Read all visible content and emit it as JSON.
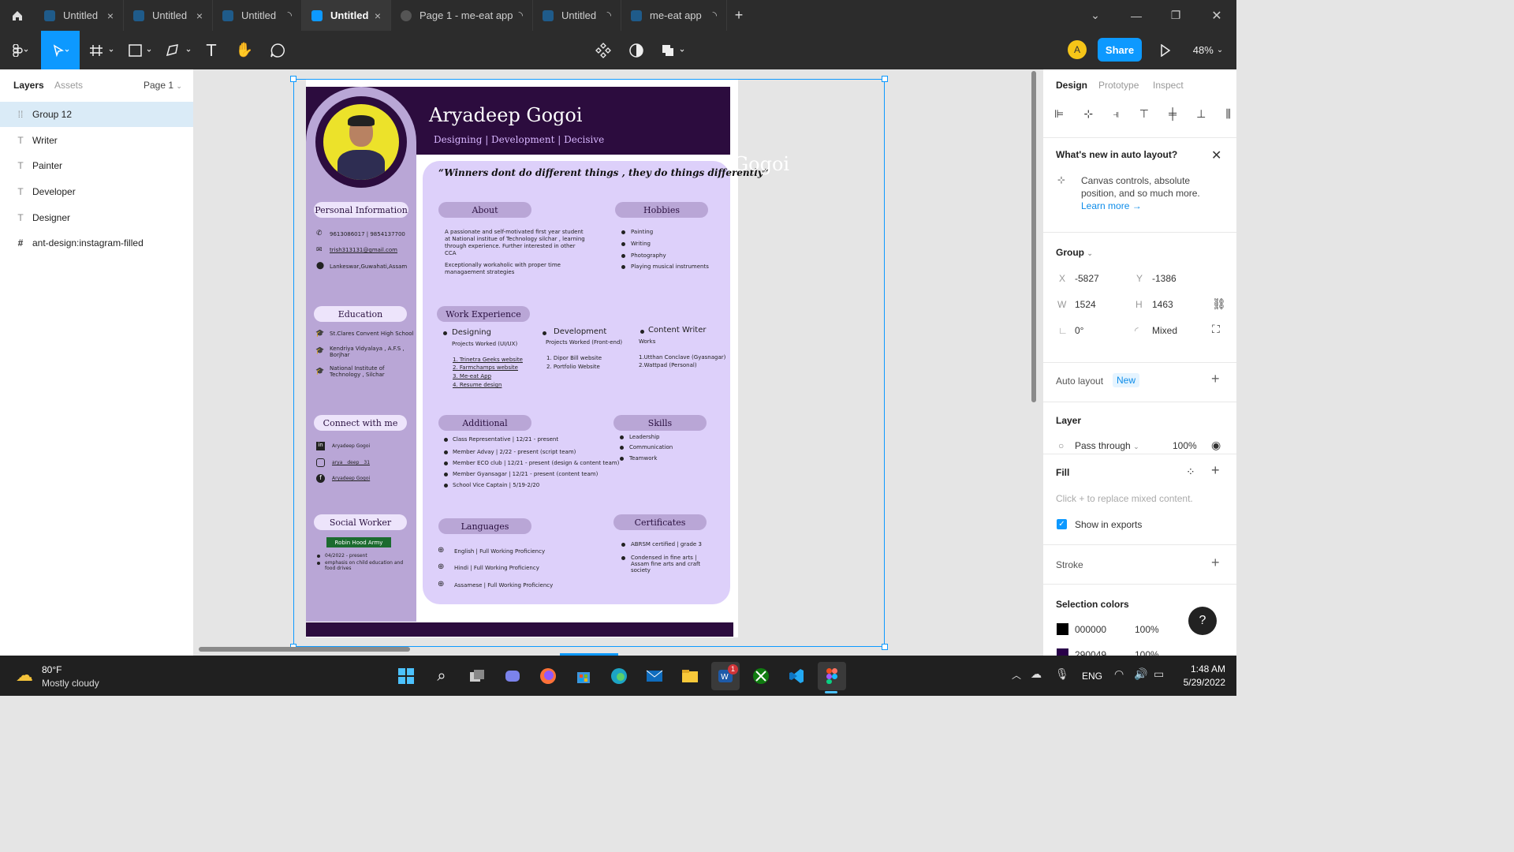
{
  "tabs": [
    {
      "label": "Untitled",
      "end": "×"
    },
    {
      "label": "Untitled",
      "end": "×"
    },
    {
      "label": "Untitled",
      "end": "◝"
    },
    {
      "label": "Untitled",
      "end": "×"
    },
    {
      "label": "Page 1 - me-eat app",
      "end": "◝"
    },
    {
      "label": "Untitled",
      "end": "◝"
    },
    {
      "label": "me-eat app",
      "end": "◝"
    }
  ],
  "toolbar": {
    "avatar": "A",
    "share": "Share",
    "zoom": "48%"
  },
  "left": {
    "tab_layers": "Layers",
    "tab_assets": "Assets",
    "page": "Page 1",
    "layers": [
      {
        "label": "Group 12",
        "icon": "group-icon"
      },
      {
        "label": "Writer",
        "icon": "text-icon"
      },
      {
        "label": "Painter",
        "icon": "text-icon"
      },
      {
        "label": "Developer",
        "icon": "text-icon"
      },
      {
        "label": "Designer",
        "icon": "text-icon"
      },
      {
        "label": "ant-design:instagram-filled",
        "icon": "frame-icon"
      }
    ]
  },
  "right": {
    "tabs": [
      "Design",
      "Prototype",
      "Inspect"
    ],
    "whatsnew_title": "What's new in auto layout?",
    "whatsnew_body": "Canvas controls, absolute position, and so much more.",
    "learn_more": "Learn more →",
    "group": "Group",
    "x_lbl": "X",
    "x": "-5827",
    "y_lbl": "Y",
    "y": "-1386",
    "w_lbl": "W",
    "w": "1524",
    "h_lbl": "H",
    "h": "1463",
    "rot": "0°",
    "radius": "Mixed",
    "autolayout": "Auto layout",
    "new_badge": "New",
    "layer": "Layer",
    "blend": "Pass through",
    "opacity": "100%",
    "fill": "Fill",
    "fill_hint": "Click + to replace mixed content.",
    "show_exports": "Show in exports",
    "stroke": "Stroke",
    "selection_colors": "Selection colors",
    "colors": [
      {
        "hex": "000000",
        "pct": "100%",
        "swatch": "#000000"
      },
      {
        "hex": "290049",
        "pct": "100%",
        "swatch": "#290049"
      }
    ],
    "help": "?"
  },
  "resume": {
    "name": "Aryadeep Gogoi",
    "tagline": "Designing | Development | Decisive",
    "quote": "“Winners dont do different things ,  they do things differently”",
    "ghost": "Gogoi",
    "personal_title": "Personal Information",
    "phone": "9613086017 | 9854137700",
    "email": "trish313131@gmail.com",
    "address": "Lankeswar,Guwahati,Assam",
    "education_title": "Education",
    "education": [
      "St.Clares Convent High School",
      "Kendriya Vidyalaya , A.F.S , Borjhar",
      "National Institute of Technology , Silchar"
    ],
    "connect_title": "Connect with me",
    "connect": [
      "Aryadeep Gogoi",
      "arya__deep__31",
      "Aryadeep Gogoi"
    ],
    "social_title": "Social Worker",
    "robin": "Robin Hood Army",
    "social_items": [
      "04/2022 - present",
      "emphasis on child education and food drives"
    ],
    "about_title": "About",
    "about_1": "A passionate and self-motivated first year student at National institue of Technology silchar , learning through experience. Further interested in other CCA",
    "about_2": "Exceptionally workaholic with proper time managaement strategies",
    "hobbies_title": "Hobbies",
    "hobbies": [
      "Painting",
      "Writing",
      "Photography",
      "Playing musical instruments"
    ],
    "work_title": "Work Experience",
    "designing": "Designing",
    "designing_sub": "Projects Worked (UI/UX)",
    "designing_list": [
      "1. Trinetra Geeks website",
      "2. Farmchamps website",
      "3. Me-eat App",
      "4. Resume design"
    ],
    "development": "Development",
    "development_sub": "Projects Worked (Front-end)",
    "development_list": [
      "1. Dipor Bill website",
      "2. Portfolio Website"
    ],
    "content": "Content Writer",
    "content_sub": "Works",
    "content_list": [
      "1.Utthan Conclave (Gyasnagar)",
      "2.Wattpad (Personal)"
    ],
    "additional_title": "Additional",
    "additional": [
      "Class Representative | 12/21 - present",
      "Member Advay | 2/22 - present (script team)",
      "Member ECO club | 12/21 - present (design & content team)",
      "Member Gyansagar | 12/21 - present (content team)",
      "School Vice Captain | 5/19-2/20"
    ],
    "skills_title": "Skills",
    "skills": [
      "Leadership",
      "Communication",
      "Teamwork"
    ],
    "languages_title": "Languages",
    "languages": [
      "English | Full Working Proficiency",
      "Hindi | Full Working Proficiency",
      "Assamese | Full Working Proficiency"
    ],
    "cert_title": "Certificates",
    "certs": [
      "ABRSM certified | grade 3",
      "Condensed in fine arts | Assam fine arts and craft society"
    ]
  },
  "taskbar": {
    "temp": "80°F",
    "weather": "Mostly cloudy",
    "lang": "ENG",
    "time": "1:48 AM",
    "date": "5/29/2022",
    "badge": "1"
  }
}
